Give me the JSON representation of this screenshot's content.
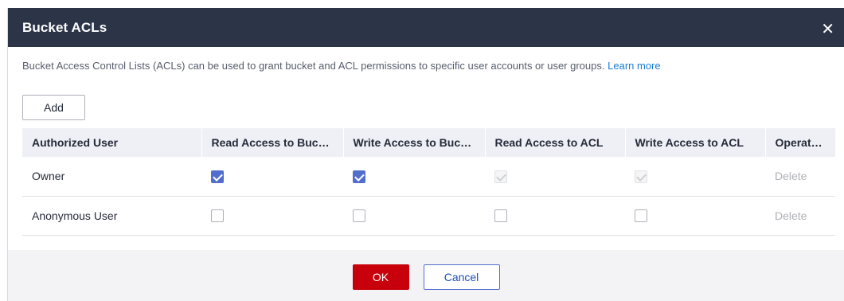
{
  "dialog": {
    "title": "Bucket ACLs",
    "close_icon": "close-icon",
    "description": "Bucket Access Control Lists (ACLs) can be used to grant bucket and ACL permissions to specific user accounts or user groups.",
    "learn_more": "Learn more",
    "add_label": "Add",
    "ok_label": "OK",
    "cancel_label": "Cancel"
  },
  "table": {
    "columns": [
      "Authorized User",
      "Read Access to Bucket",
      "Write Access to Bucket",
      "Read Access to ACL",
      "Write Access to ACL",
      "Operation"
    ],
    "rows": [
      {
        "user": "Owner",
        "read_bucket": true,
        "write_bucket": true,
        "read_acl": true,
        "write_acl": true,
        "acl_disabled": true,
        "operation": "Delete"
      },
      {
        "user": "Anonymous User",
        "read_bucket": false,
        "write_bucket": false,
        "read_acl": false,
        "write_acl": false,
        "acl_disabled": false,
        "operation": "Delete"
      }
    ]
  },
  "colors": {
    "header_bg": "#2c3447",
    "checkbox_checked": "#526ecc",
    "ok_button": "#c7000b",
    "link": "#1b7cd8"
  }
}
